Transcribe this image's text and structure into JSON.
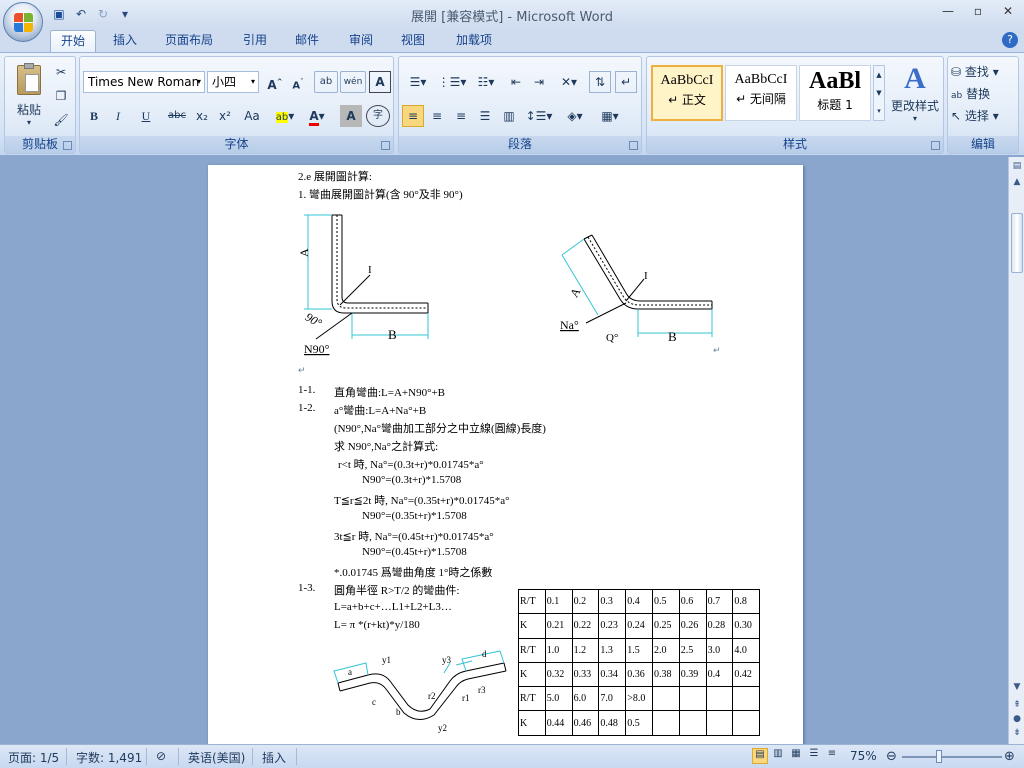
{
  "window": {
    "title": "展開 [兼容模式] - Microsoft Word",
    "controls": [
      "—",
      "▫",
      "✕"
    ]
  },
  "qat": {
    "save": "💾",
    "undo": "↶",
    "redo": "↻",
    "more": "▾"
  },
  "tabs": [
    {
      "label": "开始",
      "active": true
    },
    {
      "label": "插入"
    },
    {
      "label": "页面布局"
    },
    {
      "label": "引用"
    },
    {
      "label": "邮件"
    },
    {
      "label": "审阅"
    },
    {
      "label": "视图"
    },
    {
      "label": "加载项"
    }
  ],
  "ribbon": {
    "clipboard": {
      "label": "剪贴板",
      "paste": "粘贴"
    },
    "font": {
      "label": "字体",
      "font_name": "Times New Roman",
      "font_size": "小四",
      "bold": "B",
      "italic": "I",
      "underline": "U",
      "strike": "abc",
      "sub": "x₂",
      "sup": "x²",
      "case": "Aa",
      "grow": "A˄",
      "shrink": "A˅",
      "phonetic": "wén",
      "border_char": "A",
      "char_shade": "A",
      "enclose": "字"
    },
    "paragraph": {
      "label": "段落"
    },
    "styles": {
      "label": "样式",
      "items": [
        {
          "sample": "AaBbCcI",
          "name": "↵ 正文"
        },
        {
          "sample": "AaBbCcI",
          "name": "↵ 无间隔"
        },
        {
          "sample": "AaBl",
          "name": "标题 1"
        }
      ],
      "change": "更改样式"
    },
    "editing": {
      "label": "编辑",
      "find": "查找",
      "replace": "替换",
      "select": "选择"
    }
  },
  "document": {
    "heading": "2.e  展開圖計算:",
    "sub1": "1.   彎曲展開圖計算(含 90°及非 90°)",
    "fig1": {
      "A": "A",
      "I": "I",
      "angle": "90°",
      "B": "B",
      "label": "N90°"
    },
    "fig2": {
      "A": "A",
      "I": "I",
      "angle": "Q°",
      "B": "B",
      "label": "Na°"
    },
    "lines": [
      {
        "num": "1-1.",
        "text": "直角彎曲:L=A+N90°+B"
      },
      {
        "num": "1-2.",
        "text": "a°彎曲:L=A+Na°+B"
      },
      {
        "num": "",
        "text": "(N90°,Na°彎曲加工部分之中立線(圓線)長度)"
      },
      {
        "num": "",
        "text": "求 N90°,Na°之計算式:"
      },
      {
        "num": "",
        "text": "r<t 時, Na°=(0.3t+r)*0.01745*a°"
      },
      {
        "num": "",
        "text": "N90°=(0.3t+r)*1.5708"
      },
      {
        "num": "",
        "text": "T≦r≦2t 時, Na°=(0.35t+r)*0.01745*a°"
      },
      {
        "num": "",
        "text": "N90°=(0.35t+r)*1.5708"
      },
      {
        "num": "",
        "text": "3t≦r 時, Na°=(0.45t+r)*0.01745*a°"
      },
      {
        "num": "",
        "text": "N90°=(0.45t+r)*1.5708"
      },
      {
        "num": "",
        "text": "*.0.01745 爲彎曲角度 1°時之係數"
      },
      {
        "num": "1-3.",
        "text": "圓角半徑 R>T/2 的彎曲件:"
      },
      {
        "num": "",
        "text": "L=a+b+c+…L1+L2+L3…"
      },
      {
        "num": "",
        "text": "L= π *(r+kt)*y/180"
      }
    ],
    "table": [
      [
        "R/T",
        "0.1",
        "0.2",
        "0.3",
        "0.4",
        "0.5",
        "0.6",
        "0.7",
        "0.8"
      ],
      [
        "K",
        "0.21",
        "0.22",
        "0.23",
        "0.24",
        "0.25",
        "0.26",
        "0.28",
        "0.30"
      ],
      [
        "R/T",
        "1.0",
        "1.2",
        "1.3",
        "1.5",
        "2.0",
        "2.5",
        "3.0",
        "4.0"
      ],
      [
        "K",
        "0.32",
        "0.33",
        "0.34",
        "0.36",
        "0.38",
        "0.39",
        "0.4",
        "0.42"
      ],
      [
        "R/T",
        "5.0",
        "6.0",
        "7.0",
        ">8.0",
        "",
        "",
        "",
        ""
      ],
      [
        "K",
        "0.44",
        "0.46",
        "0.48",
        "0.5",
        "",
        "",
        "",
        ""
      ]
    ],
    "fig3": {
      "a": "a",
      "y1": "y1",
      "b": "b",
      "c": "c",
      "r1": "r1",
      "r2": "r2",
      "y2": "y2",
      "y3": "y3",
      "d": "d",
      "r3": "r3"
    }
  },
  "status": {
    "page": "页面: 1/5",
    "words": "字数: 1,491",
    "language": "英语(美国)",
    "mode": "插入",
    "zoom": "75%"
  }
}
